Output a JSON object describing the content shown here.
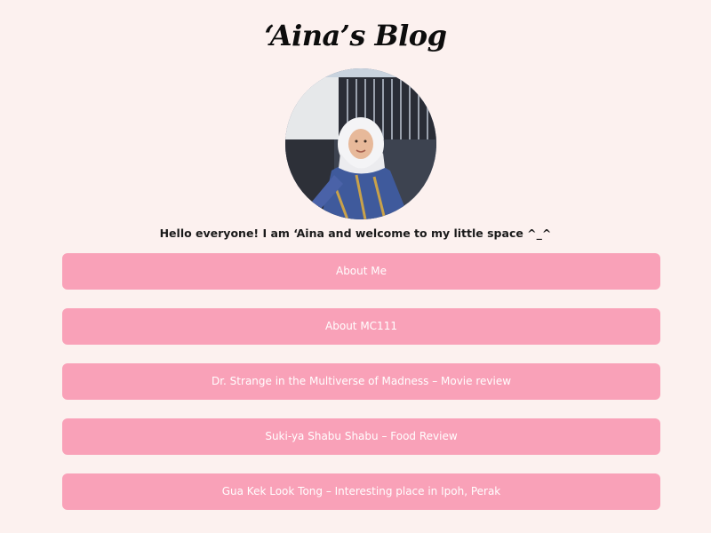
{
  "header": {
    "title": "‘Aina’s Blog"
  },
  "profile": {
    "avatar_icon": "profile-photo",
    "intro": "Hello everyone! I am ‘Aina and welcome to my little space ^_^"
  },
  "links": [
    {
      "label": "About Me"
    },
    {
      "label": "About MC111"
    },
    {
      "label": "Dr. Strange in the Multiverse of Madness – Movie review"
    },
    {
      "label": "Suki-ya Shabu Shabu – Food Review"
    },
    {
      "label": "Gua Kek Look Tong – Interesting place in Ipoh, Perak"
    }
  ],
  "colors": {
    "background": "#fcf1ef",
    "button": "#f9a1b8",
    "button_text": "#ffffff"
  }
}
